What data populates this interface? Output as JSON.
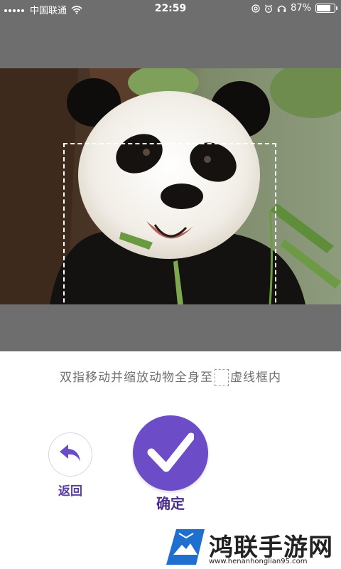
{
  "status_bar": {
    "carrier": "中国联通",
    "time": "22:59",
    "battery_text": "87%",
    "battery_level": 0.87
  },
  "photo": {
    "description_icon": "panda-photo"
  },
  "hint": {
    "text_before": "双指移动并缩放动物全身至",
    "text_after": "虚线框内"
  },
  "buttons": {
    "back_label": "返回",
    "confirm_label": "确定"
  },
  "watermark": {
    "title": "鸿联手游网",
    "url": "www.henanhonglian95.com"
  },
  "colors": {
    "accent": "#6d4cc8",
    "label": "#5b3f9e",
    "overlay": "#6e6e6e"
  }
}
